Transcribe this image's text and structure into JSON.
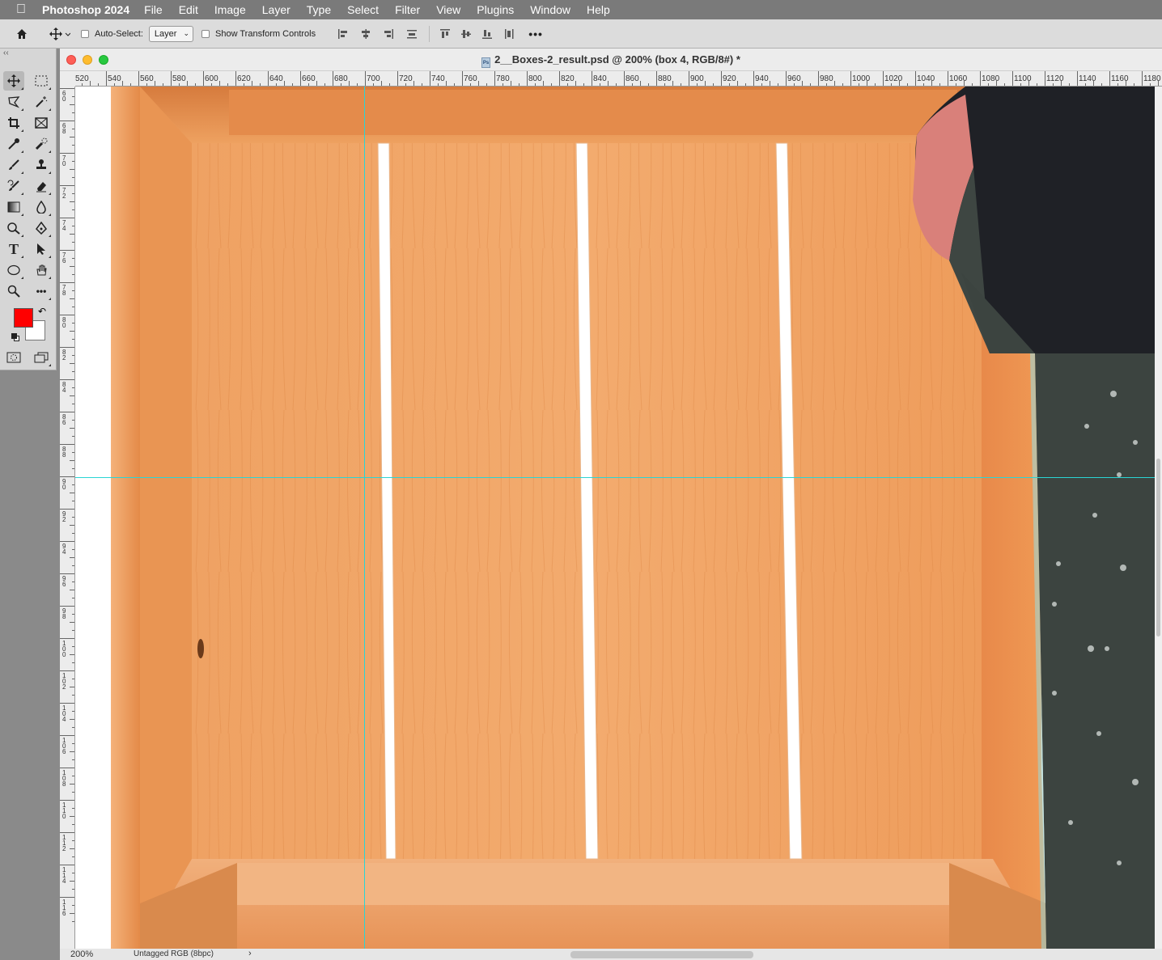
{
  "menubar": {
    "app_name": "Photoshop 2024",
    "items": [
      "File",
      "Edit",
      "Image",
      "Layer",
      "Type",
      "Select",
      "Filter",
      "View",
      "Plugins",
      "Window",
      "Help"
    ]
  },
  "options_bar": {
    "auto_select_label": "Auto-Select:",
    "auto_select_value": "Layer",
    "auto_select_checked": false,
    "show_transform_label": "Show Transform Controls",
    "show_transform_checked": false,
    "more_label": "•••"
  },
  "toolbox": {
    "tools": [
      "move-tool",
      "marquee-tool",
      "lasso-tool",
      "magic-wand-tool",
      "crop-tool",
      "frame-tool",
      "eyedropper-tool",
      "healing-brush-tool",
      "brush-tool",
      "clone-stamp-tool",
      "history-brush-tool",
      "eraser-tool",
      "gradient-tool",
      "blur-tool",
      "dodge-tool",
      "pen-tool",
      "type-tool",
      "path-selection-tool",
      "ellipse-tool",
      "hand-tool",
      "zoom-tool",
      "more-tools"
    ],
    "foreground_color": "#ff0000",
    "background_color": "#ffffff"
  },
  "document": {
    "title": "2__Boxes-2_result.psd @ 200% (box 4, RGB/8#) *",
    "zoom": "200%",
    "color_profile": "Untagged RGB (8bpc)"
  },
  "rulers": {
    "horizontal_labels": [
      "520",
      "540",
      "560",
      "580",
      "600",
      "620",
      "640",
      "660",
      "680",
      "700",
      "720",
      "740",
      "760",
      "780",
      "800",
      "820",
      "840",
      "860",
      "880",
      "900",
      "920",
      "940",
      "960",
      "980",
      "1000",
      "1020",
      "1040",
      "1060",
      "1080",
      "1100",
      "1120",
      "1140",
      "1160",
      "1180"
    ],
    "vertical_labels": [
      "6 0",
      "6 8",
      "7 0",
      "7 2",
      "7 4",
      "7 6",
      "7 8",
      "8 0",
      "8 2",
      "8 4",
      "8 6",
      "8 8",
      "9 0",
      "9 2",
      "9 4",
      "9 6",
      "9 8",
      "1 0 0",
      "1 0 2",
      "1 0 4",
      "1 0 6",
      "1 0 8",
      "1 1 0",
      "1 1 2",
      "1 1 4",
      "1 1 6"
    ]
  },
  "colors": {
    "wood": "#f0a465",
    "wood_dark": "#d8793a",
    "guide": "#2ad5d5",
    "menubar": "#7a7a7a"
  }
}
